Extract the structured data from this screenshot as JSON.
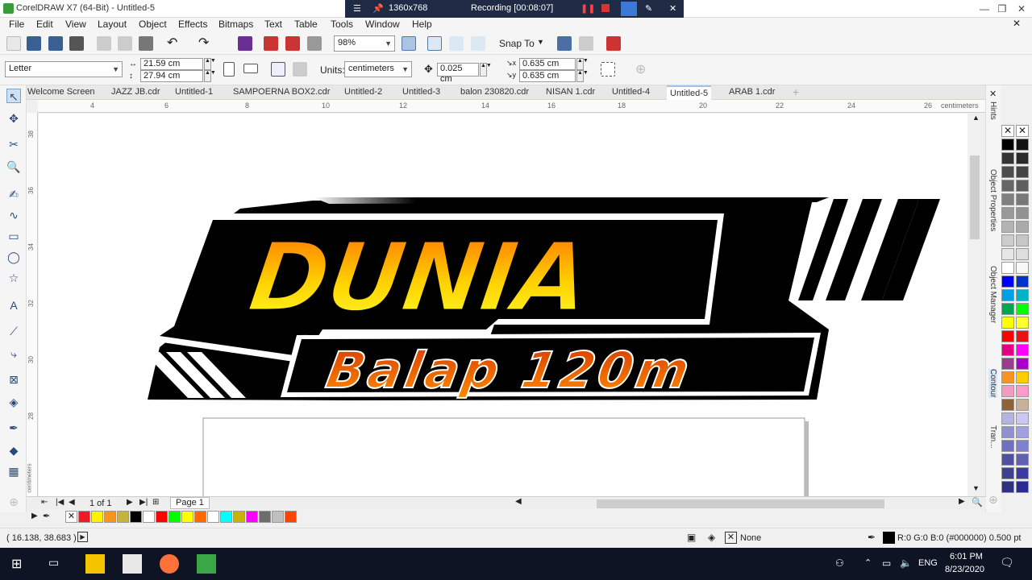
{
  "window": {
    "title": "CorelDRAW X7 (64-Bit) - Untitled-5"
  },
  "recorder": {
    "resolution": "1360x768",
    "status": "Recording [00:08:07]"
  },
  "menu": [
    "File",
    "Edit",
    "View",
    "Layout",
    "Object",
    "Effects",
    "Bitmaps",
    "Text",
    "Table",
    "Tools",
    "Window",
    "Help"
  ],
  "toolbar": {
    "zoom": "98%",
    "snap": "Snap To"
  },
  "properties": {
    "page_size": "Letter",
    "width": "21.59 cm",
    "height": "27.94 cm",
    "units_label": "Units:",
    "units": "centimeters",
    "nudge": "0.025 cm",
    "dup_x": "0.635 cm",
    "dup_y": "0.635 cm"
  },
  "tabs": [
    "Welcome Screen",
    "JAZZ JB.cdr",
    "Untitled-1",
    "SAMPOERNA BOX2.cdr",
    "Untitled-2",
    "Untitled-3",
    "balon 230820.cdr",
    "NISAN 1.cdr",
    "Untitled-4",
    "Untitled-5",
    "ARAB 1.cdr"
  ],
  "ruler": {
    "h_ticks": [
      "4",
      "6",
      "8",
      "10",
      "12",
      "14",
      "16",
      "18",
      "20",
      "22",
      "24",
      "26"
    ],
    "h_unit": "centimeters",
    "v_ticks": [
      "38",
      "36",
      "34",
      "32",
      "30",
      "28"
    ],
    "v_unit": "centimeters"
  },
  "artwork": {
    "line1": "DUNIA",
    "line2": "Balap 120m"
  },
  "pages": {
    "counter": "1 of 1",
    "tab": "Page 1"
  },
  "dockers": [
    "Hints",
    "Object Properties",
    "Object Manager",
    "Contour",
    "Tran..."
  ],
  "status": {
    "coords": "( 16.138, 38.683 )",
    "fill": "None",
    "outline": "R:0 G:0 B:0 (#000000)  0.500 pt"
  },
  "taskbar": {
    "lang": "ENG",
    "time": "6:01 PM",
    "date": "8/23/2020"
  },
  "colors": {
    "accent": "#1f2a44",
    "orange": "#ff6a00",
    "yellow": "#ffee00"
  }
}
